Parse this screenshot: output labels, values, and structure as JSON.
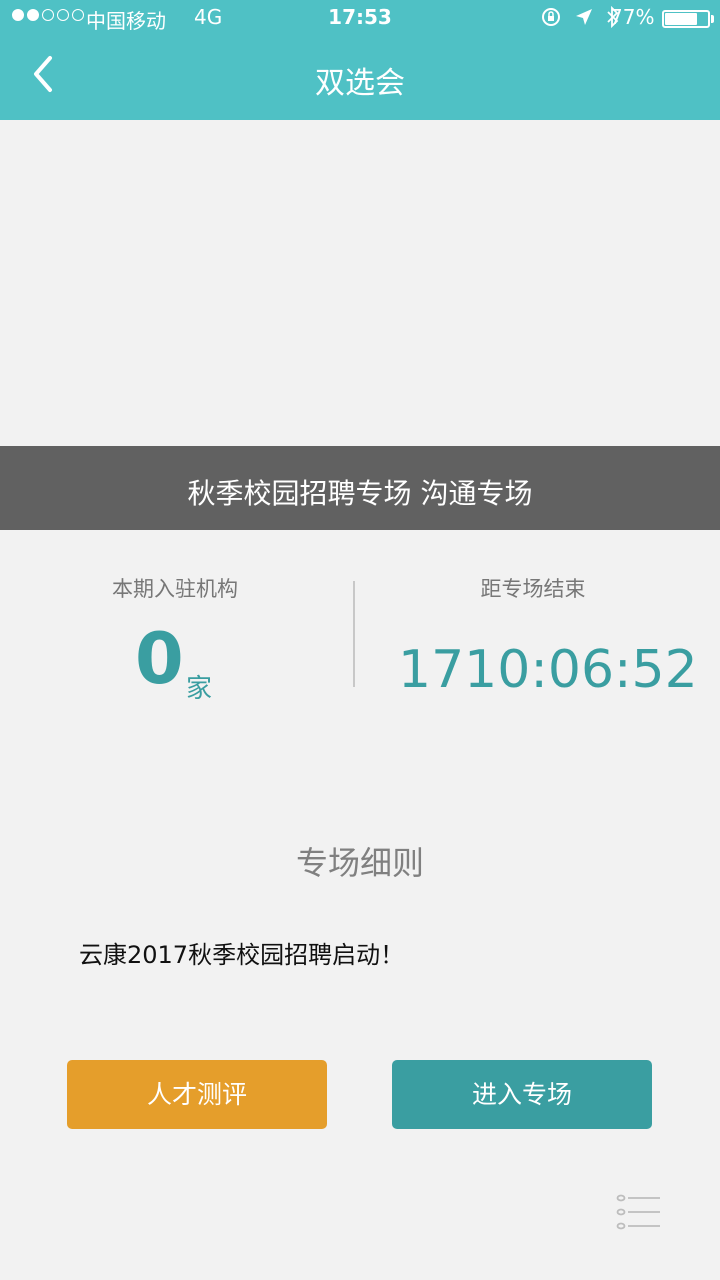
{
  "status_bar": {
    "carrier": "中国移动",
    "network": "4G",
    "time": "17:53",
    "battery_percent": "77%",
    "battery_level": 0.77,
    "signal_bars": 2
  },
  "nav": {
    "title": "双选会",
    "back_icon": "chevron-left-icon"
  },
  "banner": {
    "text": "秋季校园招聘专场 沟通专场"
  },
  "stats": {
    "organizations_label": "本期入驻机构",
    "organizations_count": "0",
    "organizations_unit": "家",
    "countdown_label": "距专场结束",
    "countdown": "1710:06:52"
  },
  "rules": {
    "title": "专场细则",
    "body": "云康2017秋季校园招聘启动！"
  },
  "buttons": {
    "assessment": "人才测评",
    "enter": "进入专场"
  },
  "colors": {
    "header": "#4fc1c5",
    "accent": "#3a9ea1",
    "assessment_button": "#e59e2b",
    "banner": "#616161",
    "background": "#f2f2f2"
  },
  "icons": {
    "menu": "list-menu-icon",
    "location": "location-arrow-icon",
    "bluetooth": "bluetooth-icon",
    "rotation_lock": "rotation-lock-icon"
  }
}
